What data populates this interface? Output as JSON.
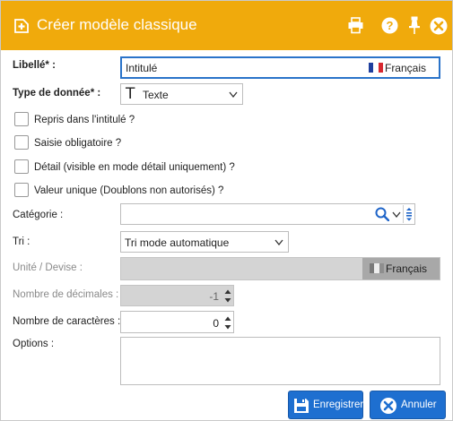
{
  "dialog": {
    "title": "Créer modèle classique"
  },
  "header_icons": [
    "add-document-icon",
    "printer-icon",
    "help-icon",
    "pin-icon",
    "close-icon"
  ],
  "fields": {
    "libelle": {
      "label": "Libellé* :",
      "value": "Intitulé",
      "language": "Français"
    },
    "type_donnee": {
      "label": "Type de donnée* :",
      "value": "Texte",
      "icon": "T"
    },
    "categorie": {
      "label": "Catégorie :",
      "value": ""
    },
    "tri": {
      "label": "Tri :",
      "value": "Tri mode automatique"
    },
    "unite": {
      "label": "Unité / Devise :",
      "value": "",
      "language": "Français"
    },
    "decimales": {
      "label": "Nombre de décimales :",
      "value": "-1"
    },
    "caracteres": {
      "label": "Nombre de caractères :",
      "value": "0"
    },
    "options": {
      "label": "Options :",
      "value": ""
    }
  },
  "checkboxes": [
    {
      "label": "Repris dans l'intitulé ?",
      "checked": false
    },
    {
      "label": "Saisie obligatoire ?",
      "checked": false
    },
    {
      "label": "Détail (visible en mode détail uniquement) ?",
      "checked": false
    },
    {
      "label": "Valeur unique (Doublons non autorisés) ?",
      "checked": false
    }
  ],
  "buttons": {
    "save": "Enregistrer",
    "cancel": "Annuler"
  },
  "colors": {
    "titlebar": "#f0aa0c",
    "primary_button": "#1e6fd0",
    "focus_border": "#2a73c9",
    "disabled_bg": "#d4d4d4"
  }
}
